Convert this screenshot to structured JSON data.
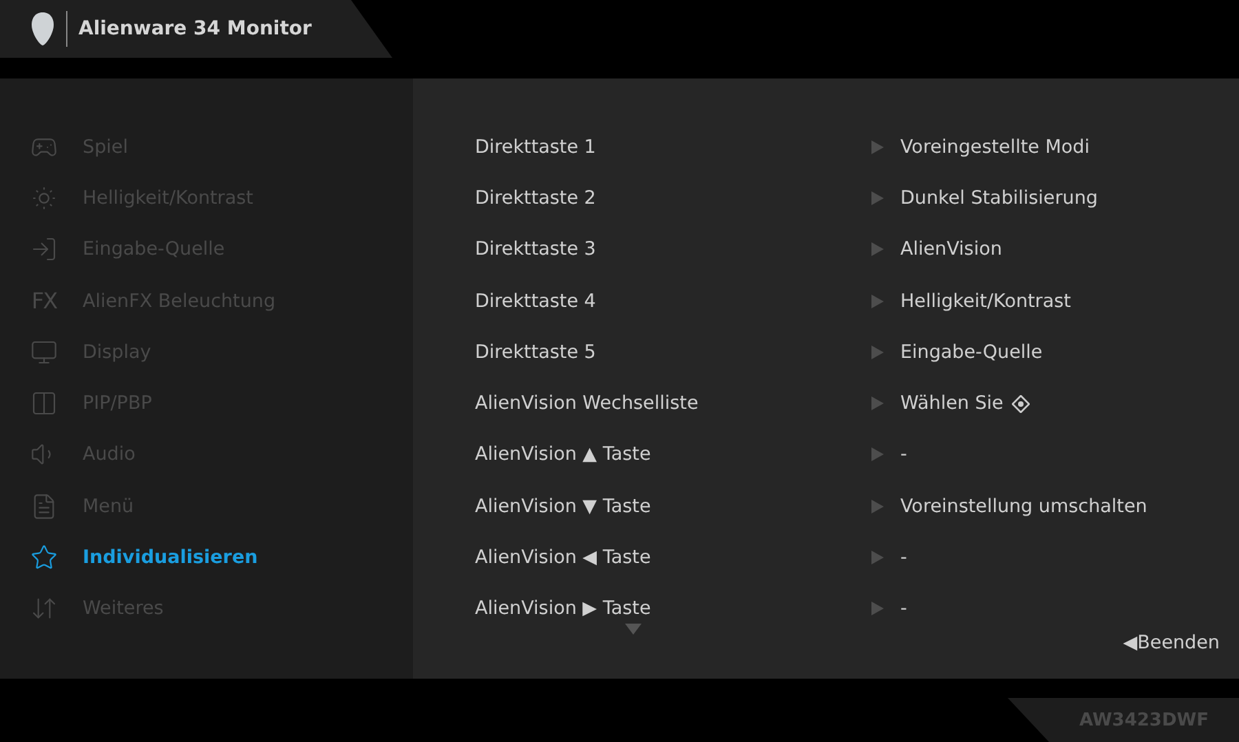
{
  "header": {
    "title": "Alienware 34 Monitor"
  },
  "sidebar": {
    "items": [
      {
        "label": "Spiel",
        "selected": false
      },
      {
        "label": "Helligkeit/Kontrast",
        "selected": false
      },
      {
        "label": "Eingabe-Quelle",
        "selected": false
      },
      {
        "label": "AlienFX Beleuchtung",
        "icon_text": "FX",
        "selected": false
      },
      {
        "label": "Display",
        "selected": false
      },
      {
        "label": "PIP/PBP",
        "selected": false
      },
      {
        "label": "Audio",
        "selected": false
      },
      {
        "label": "Menü",
        "selected": false
      },
      {
        "label": "Individualisieren",
        "selected": true
      },
      {
        "label": "Weiteres",
        "selected": false
      }
    ]
  },
  "settings": [
    {
      "label": "Direkttaste 1",
      "value": "Voreingestellte Modi"
    },
    {
      "label": "Direkttaste 2",
      "value": "Dunkel Stabilisierung"
    },
    {
      "label": "Direkttaste 3",
      "value": "AlienVision"
    },
    {
      "label": "Direkttaste 4",
      "value": "Helligkeit/Kontrast"
    },
    {
      "label": "Direkttaste 5",
      "value": "Eingabe-Quelle"
    },
    {
      "label": "AlienVision Wechselliste",
      "value": "Wählen Sie",
      "kind": "with-icon"
    },
    {
      "label": "AlienVision ▲ Taste",
      "value": "-"
    },
    {
      "label": "AlienVision ▼ Taste",
      "value": "Voreinstellung umschalten"
    },
    {
      "label": "AlienVision ◀ Taste",
      "value": "-"
    },
    {
      "label": "AlienVision ▶ Taste",
      "value": "-"
    }
  ],
  "exit_button": "◀Beenden",
  "model": "AW3423DWF"
}
